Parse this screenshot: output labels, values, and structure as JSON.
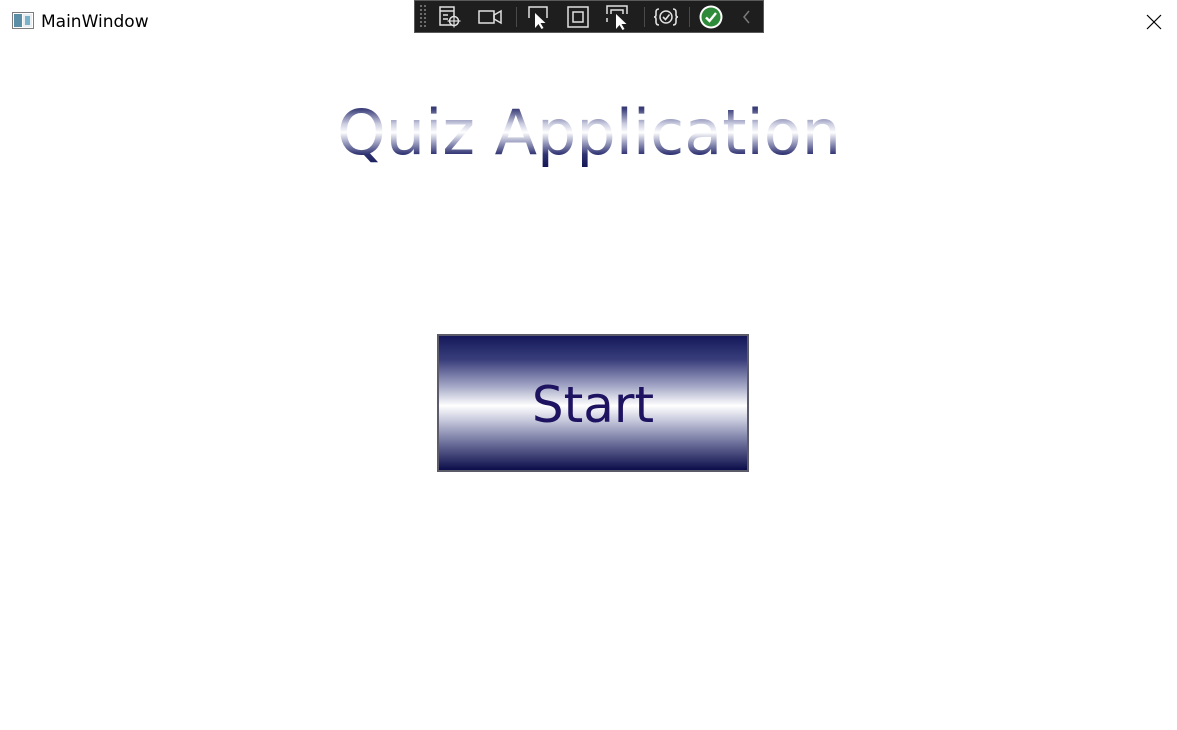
{
  "window": {
    "title": "MainWindow"
  },
  "main": {
    "heading": "Quiz Application",
    "start_label": "Start"
  },
  "colors": {
    "heading_dark": "#1a1f5c",
    "heading_light": "#ffffff",
    "start_text": "#1e1360",
    "toolbar_bg": "#1e1e1e",
    "check_green": "#2e8b3a"
  },
  "dev_toolbar": {
    "tools": [
      "live-visual-tree-icon",
      "video-camera-icon",
      "select-element-icon",
      "display-layout-adorners-icon",
      "track-focus-icon",
      "hot-reload-icon",
      "binding-check-icon",
      "collapse-chevron-icon"
    ]
  }
}
